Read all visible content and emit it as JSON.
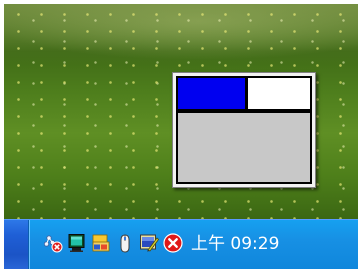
{
  "taskbar": {
    "clock": {
      "text": "上午 09:29"
    },
    "tray_icons": [
      "network-disconnected-icon",
      "monitor-icon",
      "folder-icon",
      "mouse-icon",
      "tool-icon",
      "error-icon"
    ]
  },
  "mini_window": {
    "panes": [
      {
        "name": "top-left",
        "color": "#0000f0"
      },
      {
        "name": "top-right",
        "color": "#ffffff"
      },
      {
        "name": "bottom",
        "color": "#c8c8c8"
      }
    ]
  },
  "colors": {
    "taskbar_blue": "#1f5fd6",
    "tray_blue": "#1790e4",
    "wallpaper_green": "#4d7d1c"
  }
}
